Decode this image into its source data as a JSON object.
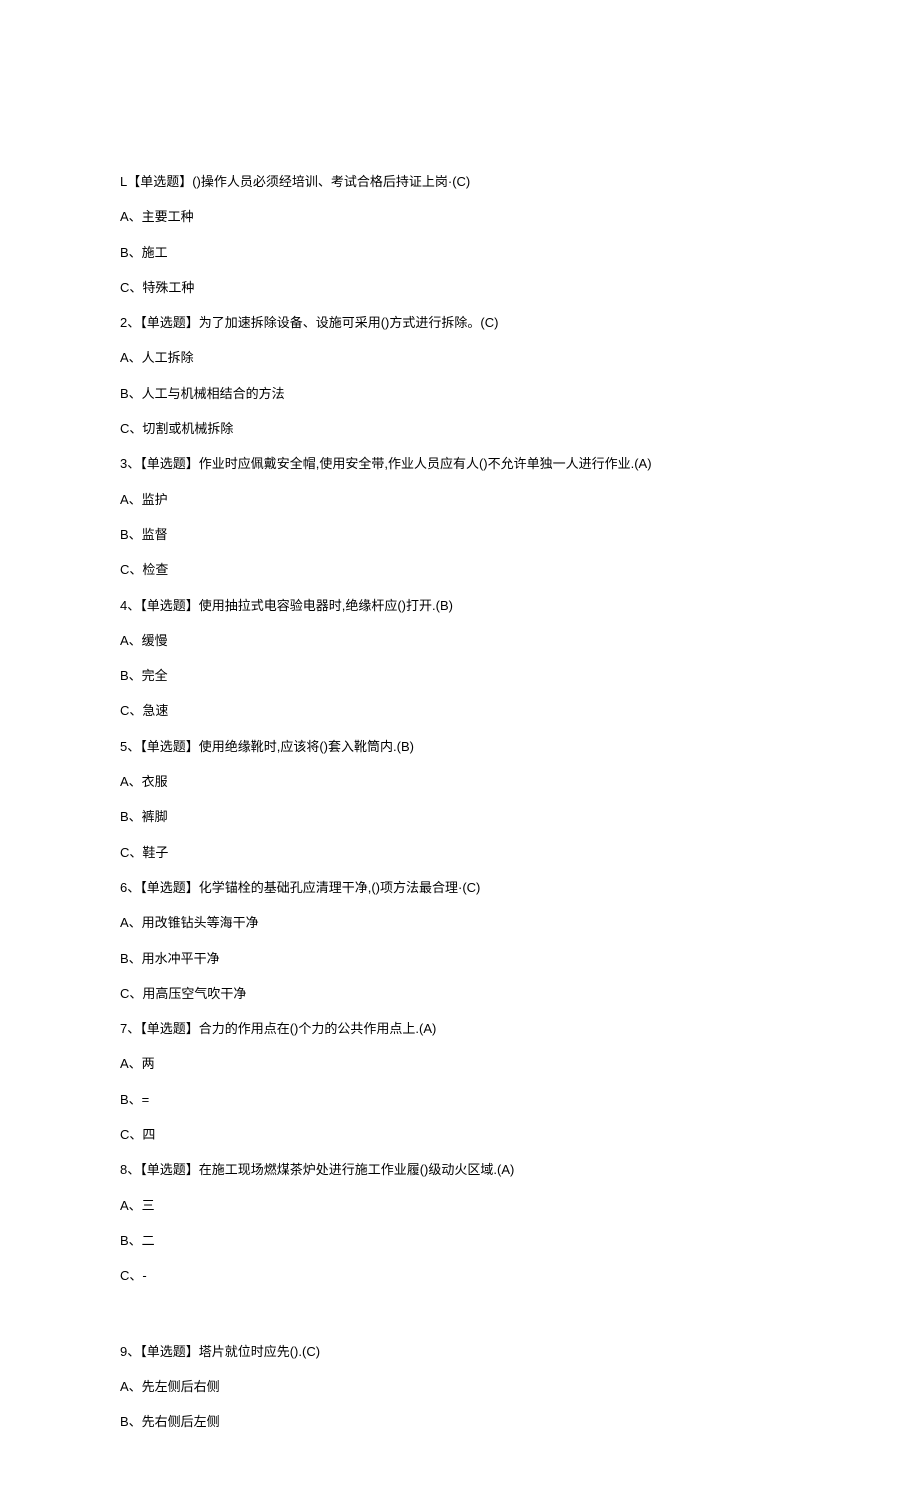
{
  "lines": [
    "L【单选题】()操作人员必须经培训、考试合格后持证上岗·(C)",
    "A、主要工种",
    "B、施工",
    "C、特殊工种",
    "2、【单选题】为了加速拆除设备、设施可采用()方式进行拆除。(C)",
    "A、人工拆除",
    "B、人工与机械相结合的方法",
    "C、切割或机械拆除",
    "3、【单选题】作业时应佩戴安全帽,使用安全带,作业人员应有人()不允许单独一人进行作业.(A)",
    "A、监护",
    "B、监督",
    "C、检查",
    "4、【单选题】使用抽拉式电容验电器时,绝缘杆应()打开.(B)",
    "A、缓慢",
    "B、完全",
    "C、急速",
    "5、【单选题】使用绝缘靴时,应该将()套入靴筒内.(B)",
    "A、衣服",
    "B、裤脚",
    "C、鞋子",
    "6、【单选题】化学锚栓的基础孔应清理干净,()项方法最合理·(C)",
    "A、用改锥钻头等海干净",
    "B、用水冲平干净",
    "C、用高压空气吹干净",
    "7、【单选题】合力的作用点在()个力的公共作用点上.(A)",
    "A、两",
    "B、=",
    "C、四",
    "8、【单选题】在施工现场燃煤茶炉处进行施工作业履()级动火区域.(A)",
    "A、三",
    "B、二",
    "C、-"
  ],
  "lines2": [
    "9、【单选题】塔片就位时应先().(C)",
    "A、先左侧后右侧",
    "B、先右侧后左侧"
  ]
}
